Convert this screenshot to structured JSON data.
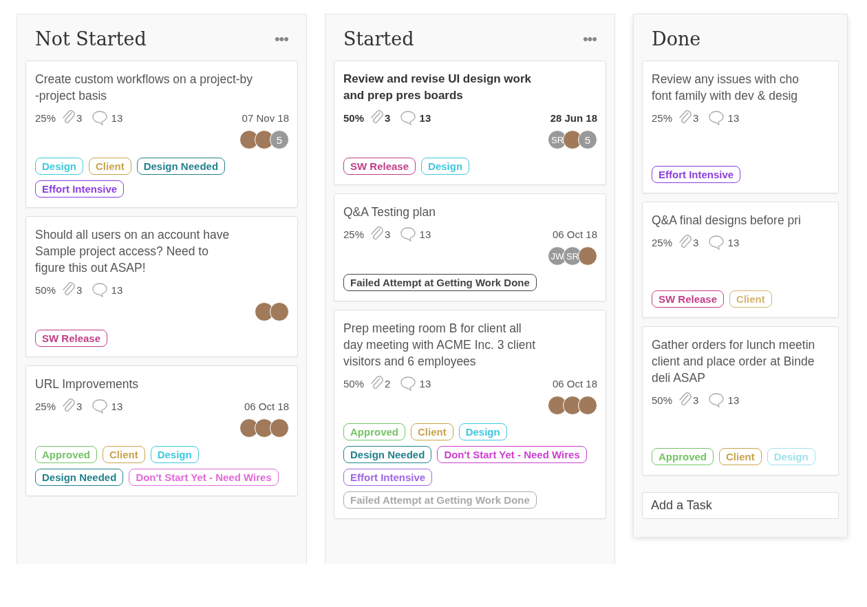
{
  "columns": [
    {
      "title": "Not Started",
      "menu": "•••",
      "cards": [
        {
          "title": "Create custom workflows on a project-by\n-project basis",
          "emphasized": false,
          "progress": "25%",
          "attachments": "3",
          "comments": "13",
          "date": "07 Nov 18",
          "avatars": [
            {
              "kind": "photo"
            },
            {
              "kind": "photo"
            },
            {
              "kind": "count",
              "text": "5"
            }
          ],
          "tags": [
            {
              "label": "Design",
              "color": "#3ec9de"
            },
            {
              "label": "Client",
              "color": "#c8a44c"
            },
            {
              "label": "Design Needed",
              "color": "#23818d"
            },
            {
              "label": "Effort Intensive",
              "color": "#8b3fe0"
            }
          ]
        },
        {
          "title": "Should all users on an account have\nSample project access? Need to\nfigure this out ASAP!",
          "emphasized": false,
          "progress": "50%",
          "attachments": "3",
          "comments": "13",
          "avatars": [
            {
              "kind": "photo"
            },
            {
              "kind": "photo"
            }
          ],
          "tags": [
            {
              "label": "SW Release",
              "color": "#c23e88"
            }
          ]
        },
        {
          "title": "URL Improvements",
          "emphasized": false,
          "progress": "25%",
          "attachments": "3",
          "comments": "13",
          "date": "06 Oct 18",
          "avatars": [
            {
              "kind": "photo"
            },
            {
              "kind": "photo"
            },
            {
              "kind": "photo"
            }
          ],
          "tags": [
            {
              "label": "Approved",
              "color": "#74c466"
            },
            {
              "label": "Client",
              "color": "#c8a44c"
            },
            {
              "label": "Design",
              "color": "#3ec9de"
            },
            {
              "label": "Design Needed",
              "color": "#23818d"
            },
            {
              "label": "Don't Start Yet - Need Wires",
              "color": "#e26ad8"
            }
          ]
        }
      ]
    },
    {
      "title": "Started",
      "menu": "•••",
      "cards": [
        {
          "title": "Review and revise UI design work\nand prep pres boards",
          "emphasized": true,
          "progress": "50%",
          "attachments": "3",
          "comments": "13",
          "date": "28 Jun 18",
          "avatars": [
            {
              "kind": "initials",
              "text": "SR"
            },
            {
              "kind": "photo"
            },
            {
              "kind": "count",
              "text": "5"
            }
          ],
          "tags": [
            {
              "label": "SW Release",
              "color": "#c23e88"
            },
            {
              "label": "Design",
              "color": "#3ec9de"
            }
          ]
        },
        {
          "title": "Q&A Testing plan",
          "emphasized": false,
          "progress": "25%",
          "attachments": "3",
          "comments": "13",
          "date": "06 Oct 18",
          "avatars": [
            {
              "kind": "initials",
              "text": "JW"
            },
            {
              "kind": "initials",
              "text": "SR"
            },
            {
              "kind": "photo"
            }
          ],
          "tags": [
            {
              "label": "Failed Attempt at Getting Work Done",
              "color": "#444444"
            }
          ]
        },
        {
          "title": "Prep meeting room B for client all\nday meeting with ACME Inc. 3 client\nvisitors and 6 employees",
          "emphasized": false,
          "progress": "50%",
          "attachments": "2",
          "comments": "13",
          "date": "06 Oct 18",
          "avatars": [
            {
              "kind": "photo"
            },
            {
              "kind": "photo"
            },
            {
              "kind": "photo"
            }
          ],
          "tags": [
            {
              "label": "Approved",
              "color": "#74c466"
            },
            {
              "label": "Client",
              "color": "#c8a44c"
            },
            {
              "label": "Design",
              "color": "#3ec9de"
            },
            {
              "label": "Design Needed",
              "color": "#23818d"
            },
            {
              "label": "Don't Start Yet - Need Wires",
              "color": "#cc3fd0"
            },
            {
              "label": "Effort Intensive",
              "color": "#a066e6"
            },
            {
              "label": "Failed Attempt at Getting Work Done",
              "color": "#aaaaaa"
            }
          ]
        }
      ]
    },
    {
      "title": "Done",
      "cards": [
        {
          "title": "Review any issues with cho\nfont family with dev & desig",
          "emphasized": false,
          "progress": "25%",
          "attachments": "3",
          "comments": "13",
          "tags": [
            {
              "label": "Effort Intensive",
              "color": "#8b3fe0"
            }
          ]
        },
        {
          "title": "Q&A final designs before pri",
          "emphasized": false,
          "progress": "25%",
          "attachments": "3",
          "comments": "13",
          "tags": [
            {
              "label": "SW Release",
              "color": "#c23e88"
            },
            {
              "label": "Client",
              "color": "#d4b570"
            }
          ]
        },
        {
          "title": "Gather orders for lunch meetin\nclient and place order at Binde\ndeli ASAP",
          "emphasized": false,
          "progress": "50%",
          "attachments": "3",
          "comments": "13",
          "tags": [
            {
              "label": "Approved",
              "color": "#74c466"
            },
            {
              "label": "Client",
              "color": "#c8a44c"
            },
            {
              "label": "Design",
              "color": "#9fe2ec"
            }
          ]
        }
      ],
      "add_task": {
        "placeholder": "Add a Task"
      }
    }
  ]
}
